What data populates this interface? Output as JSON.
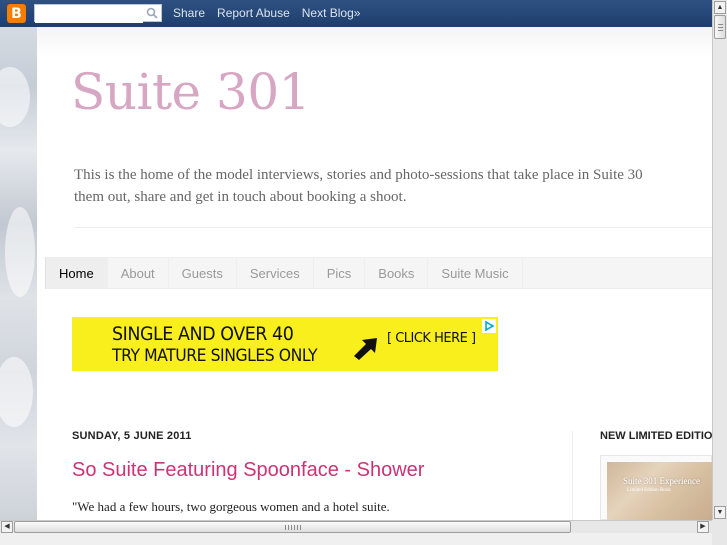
{
  "navbar": {
    "search_placeholder": "",
    "links": [
      "Share",
      "Report Abuse",
      "Next Blog»"
    ]
  },
  "header": {
    "title": "Suite 301",
    "description_line1": "This is the home of the model interviews, stories and photo-sessions that take place in Suite 30",
    "description_line2": "them out, share and get in touch about booking a shoot."
  },
  "tabs": [
    {
      "label": "Home",
      "active": true
    },
    {
      "label": "About",
      "active": false
    },
    {
      "label": "Guests",
      "active": false
    },
    {
      "label": "Services",
      "active": false
    },
    {
      "label": "Pics",
      "active": false
    },
    {
      "label": "Books",
      "active": false
    },
    {
      "label": "Suite Music",
      "active": false
    }
  ],
  "ad": {
    "line1": "SINGLE AND OVER 40",
    "line2": "TRY MATURE SINGLES ONLY",
    "cta": "[ CLICK HERE ]"
  },
  "post": {
    "date": "SUNDAY, 5 JUNE 2011",
    "title": "So Suite Featuring Spoonface - Shower",
    "body": "\"We had a few hours, two gorgeous women and a hotel suite."
  },
  "sidebar": {
    "title": "NEW LIMITED EDITION",
    "image_caption": "Suite 301 Experience",
    "image_subcaption": "Limited Edition Book"
  },
  "colors": {
    "title": "#d7a6c2",
    "post_title": "#cc3377",
    "navbar": "#2f5182",
    "ad_background": "#f8ef1c",
    "blogger_orange": "#f57d00"
  }
}
